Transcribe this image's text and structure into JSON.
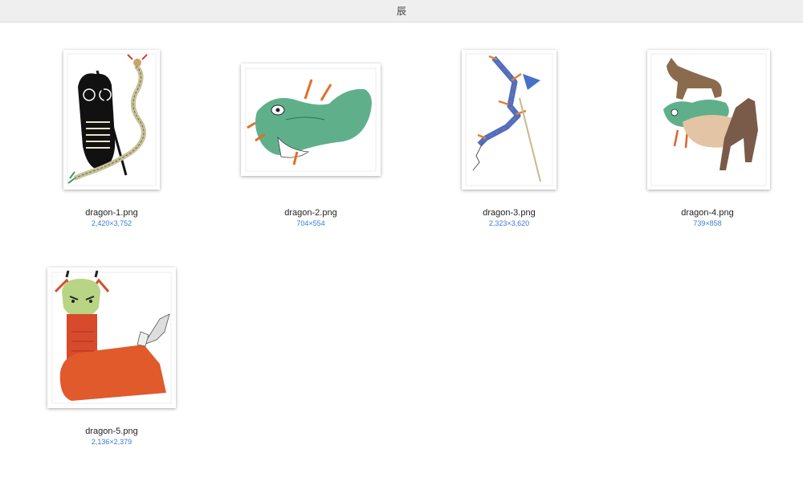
{
  "window": {
    "title": "辰"
  },
  "files": [
    {
      "name": "dragon-1.png",
      "dimensions": "2,420×3,752"
    },
    {
      "name": "dragon-2.png",
      "dimensions": "704×554"
    },
    {
      "name": "dragon-3.png",
      "dimensions": "2,323×3,620"
    },
    {
      "name": "dragon-4.png",
      "dimensions": "739×858"
    },
    {
      "name": "dragon-5.png",
      "dimensions": "2,136×2,379"
    }
  ]
}
